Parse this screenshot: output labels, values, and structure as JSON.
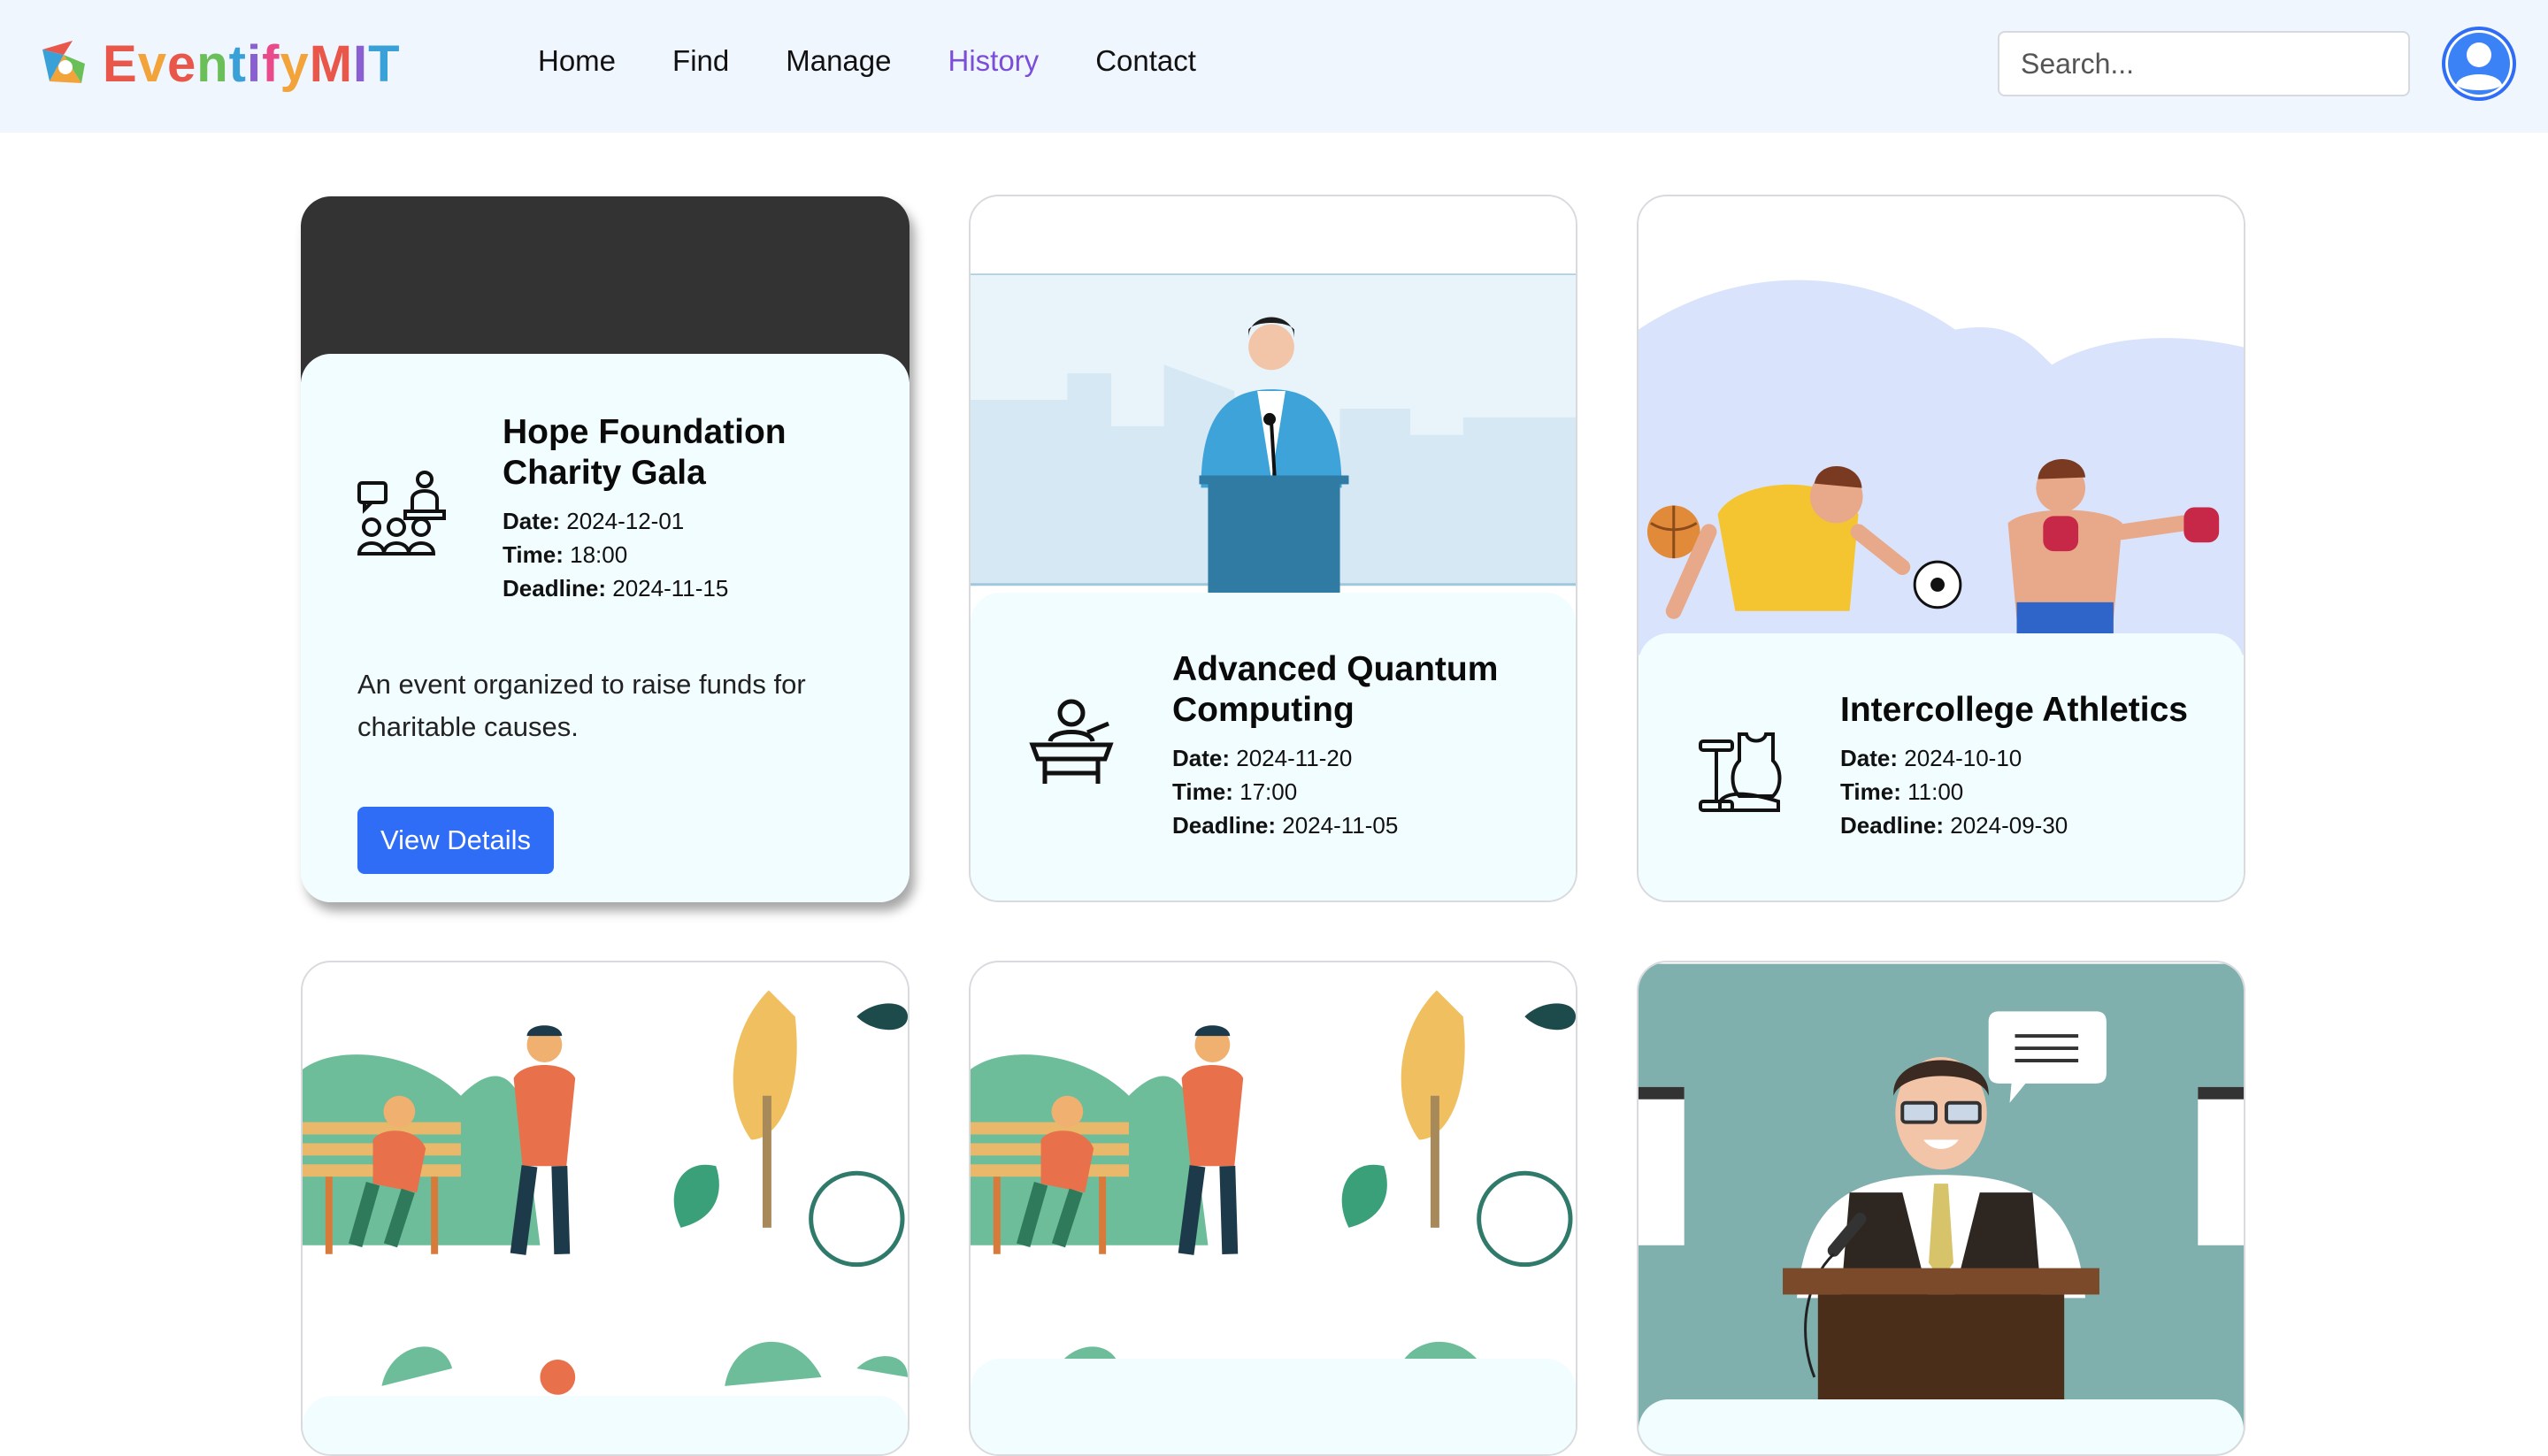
{
  "navbar": {
    "brand": "EventifyMIT",
    "links": [
      "Home",
      "Find",
      "Manage",
      "History",
      "Contact"
    ],
    "active_link": "History",
    "search_placeholder": "Search..."
  },
  "events": [
    {
      "title_line1": "Hope Foundation",
      "title_line2": "Charity Gala",
      "date_label": "Date:",
      "date": "2024-12-01",
      "time_label": "Time:",
      "time": "18:00",
      "deadline_label": "Deadline:",
      "deadline": "2024-11-15",
      "description_line1": "An event organized to raise funds for",
      "description_line2": "charitable causes.",
      "button": "View Details",
      "icon": "charity-people-icon"
    },
    {
      "title_line1": "Advanced Quantum",
      "title_line2": "Computing",
      "date_label": "Date:",
      "date": "2024-11-20",
      "time_label": "Time:",
      "time": "17:00",
      "deadline_label": "Deadline:",
      "deadline": "2024-11-05",
      "icon": "lecture-desk-icon"
    },
    {
      "title_line1": "Intercollege Athletics",
      "date_label": "Date:",
      "date": "2024-10-10",
      "time_label": "Time:",
      "time": "11:00",
      "deadline_label": "Deadline:",
      "deadline": "2024-09-30",
      "icon": "sports-equipment-icon"
    }
  ],
  "colors": {
    "navbar_bg": "#eff6fe",
    "active_link": "#7b4dd8",
    "button": "#2f6df6",
    "card_body": "#f1fdfe"
  }
}
